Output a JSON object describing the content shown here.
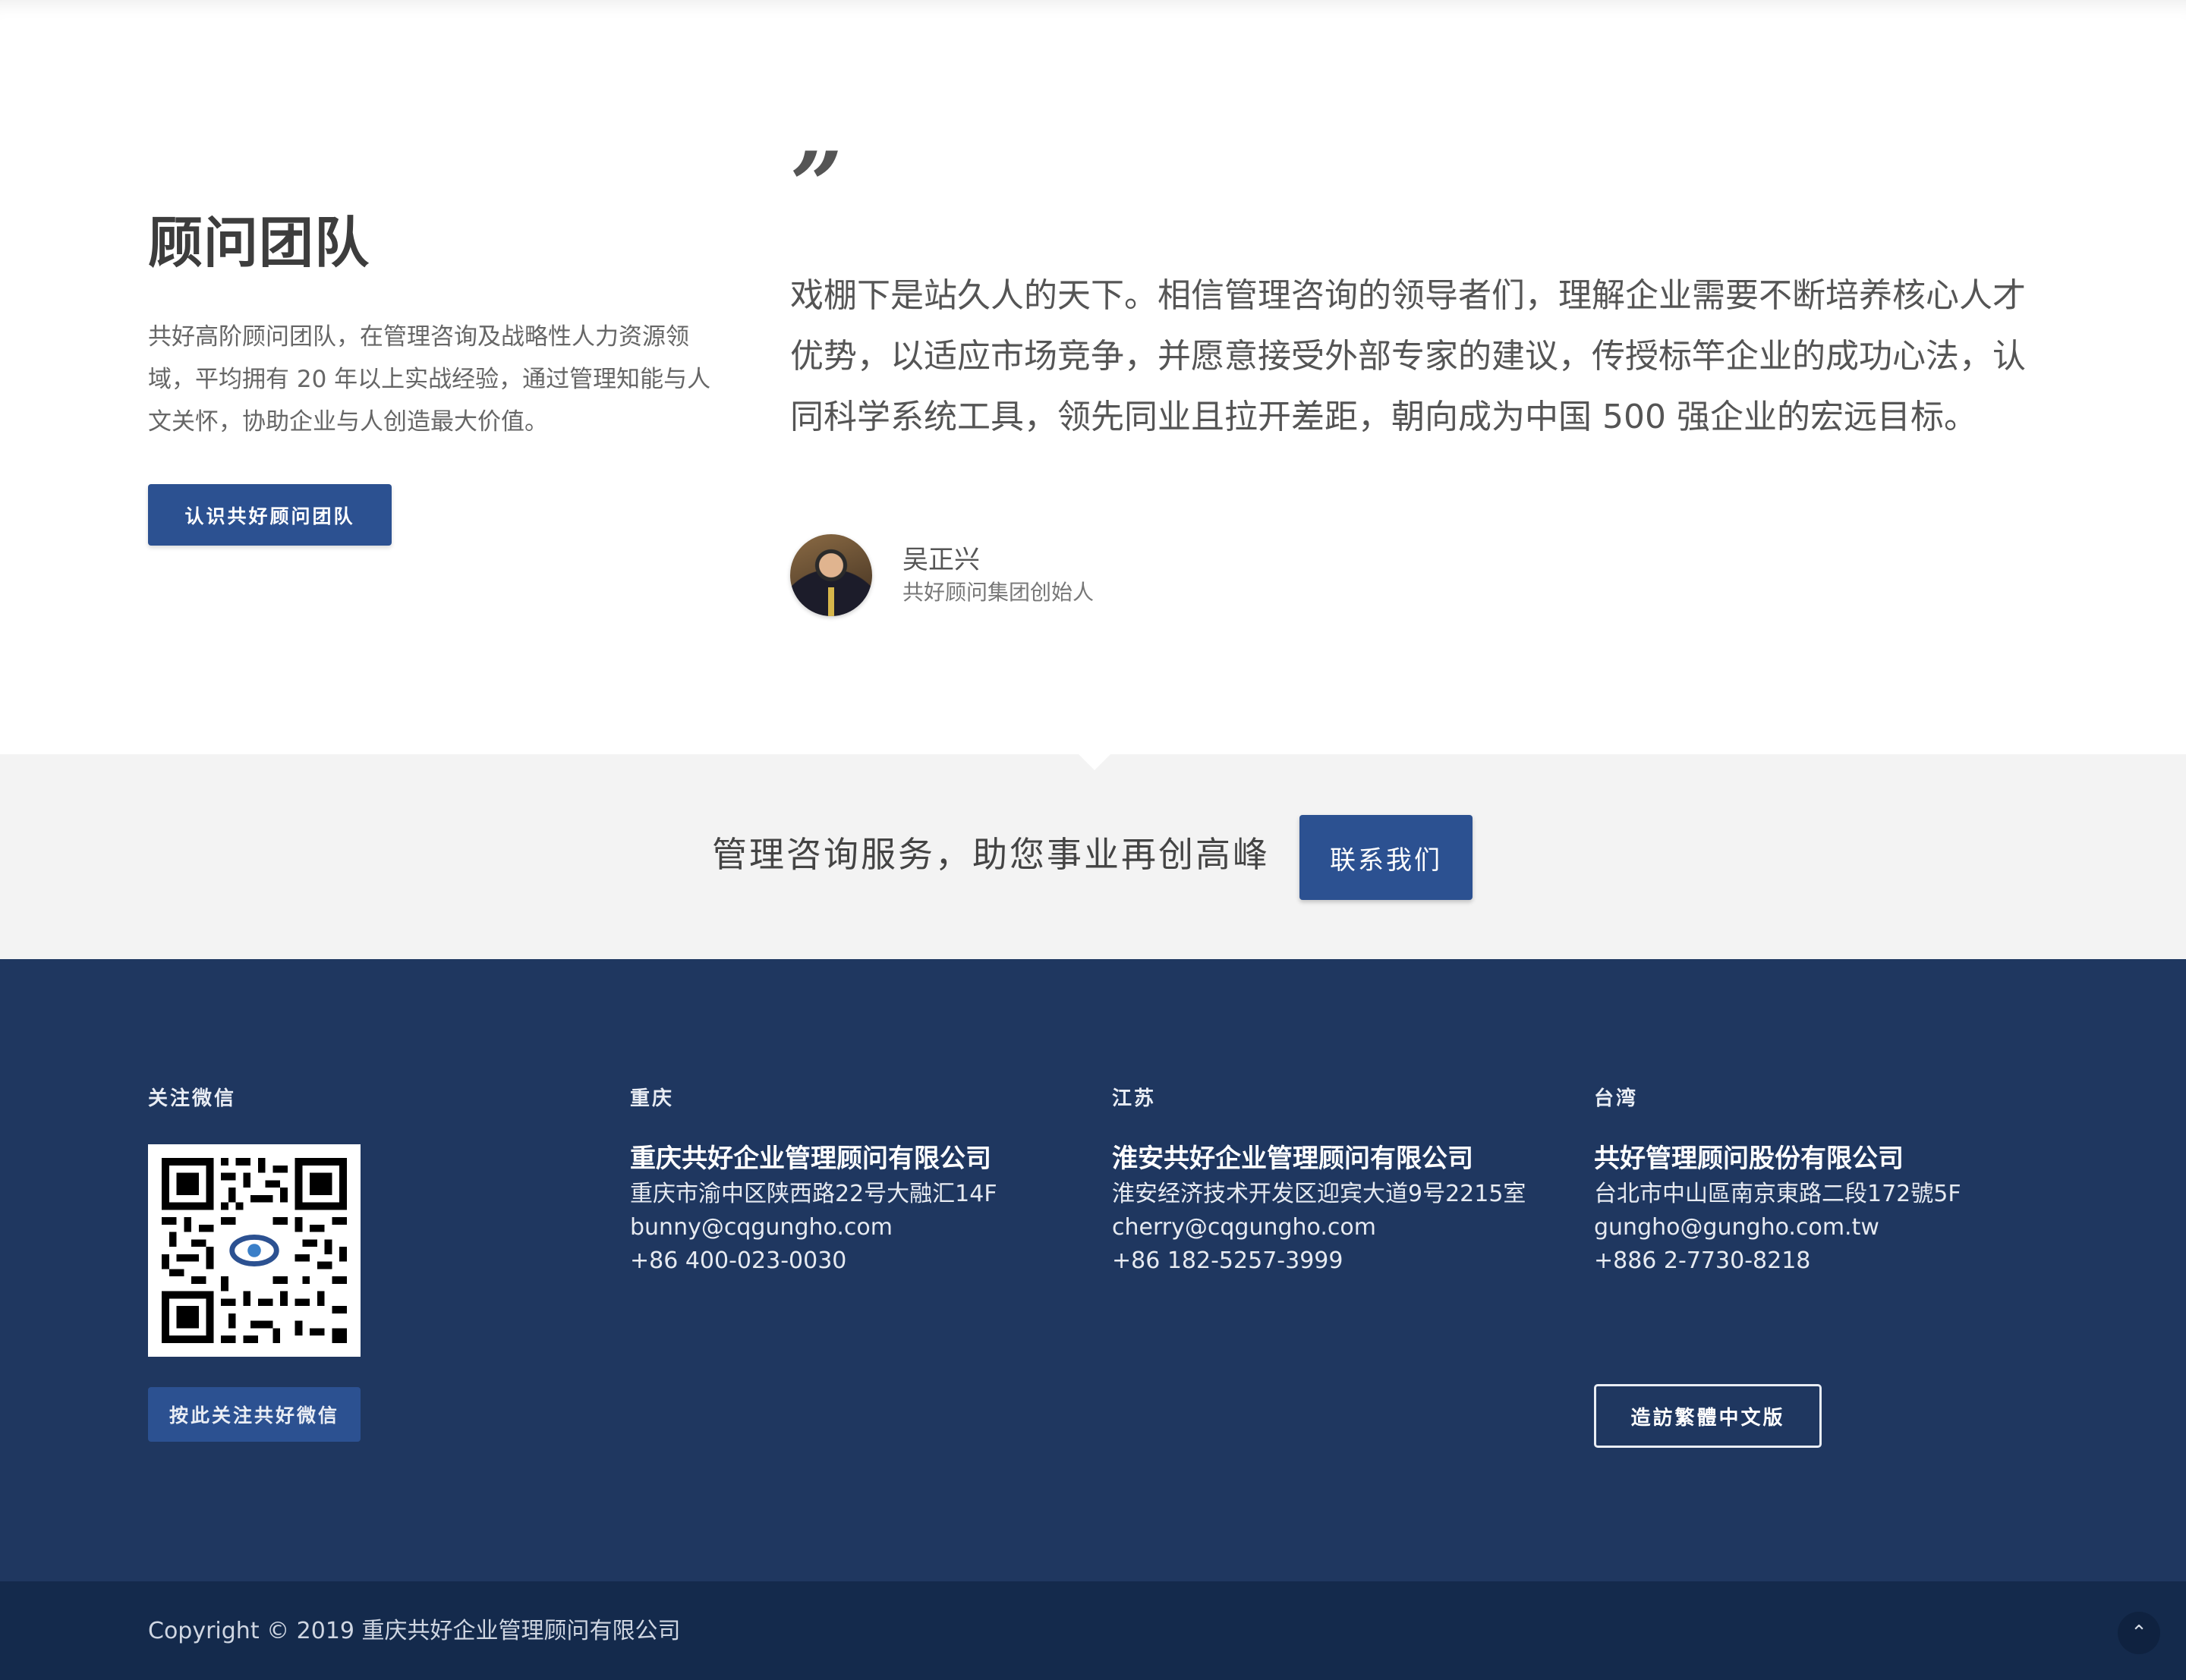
{
  "team": {
    "title": "顾问团队",
    "description": "共好高阶顾问团队，在管理咨询及战略性人力资源领域，平均拥有 20 年以上实战经验，通过管理知能与人文关怀，协助企业与人创造最大价值。",
    "button_label": "认识共好顾问团队"
  },
  "quote": {
    "mark": "”",
    "text": "戏棚下是站久人的天下。相信管理咨询的领导者们，理解企业需要不断培养核心人才优势，以适应市场竞争，并愿意接受外部专家的建议，传授标竿企业的成功心法，认同科学系统工具，领先同业且拉开差距，朝向成为中国 500 强企业的宏远目标。",
    "author_name": "吴正兴",
    "author_role": "共好顾问集团创始人"
  },
  "cta": {
    "text": "管理咨询服务，助您事业再创高峰",
    "button_label": "联系我们"
  },
  "footer": {
    "wechat": {
      "heading": "关注微信",
      "button_label": "按此关注共好微信"
    },
    "offices": [
      {
        "heading": "重庆",
        "company": "重庆共好企业管理顾问有限公司",
        "address": "重庆市渝中区陕西路22号大融汇14F",
        "email": "bunny@cqgungho.com",
        "phone": "+86 400-023-0030"
      },
      {
        "heading": "江苏",
        "company": "淮安共好企业管理顾问有限公司",
        "address": "淮安经济技术开发区迎宾大道9号2215室",
        "email": "cherry@cqgungho.com",
        "phone": "+86 182-5257-3999"
      },
      {
        "heading": "台湾",
        "company": "共好管理顾问股份有限公司",
        "address": "台北市中山區南京東路二段172號5F",
        "email": "gungho@gungho.com.tw",
        "phone": "+886 2-7730-8218"
      }
    ],
    "traditional_button_label": "造訪繁體中文版"
  },
  "copyright": {
    "text": "Copyright © 2019 重庆共好企业管理顾问有限公司",
    "back_to_top_icon": "chevron-up-icon"
  },
  "colors": {
    "primary_button": "#2c5191",
    "footer_bg": "#1f3760",
    "copyright_bg": "#142a4c",
    "cta_bg": "#f3f3f3"
  }
}
